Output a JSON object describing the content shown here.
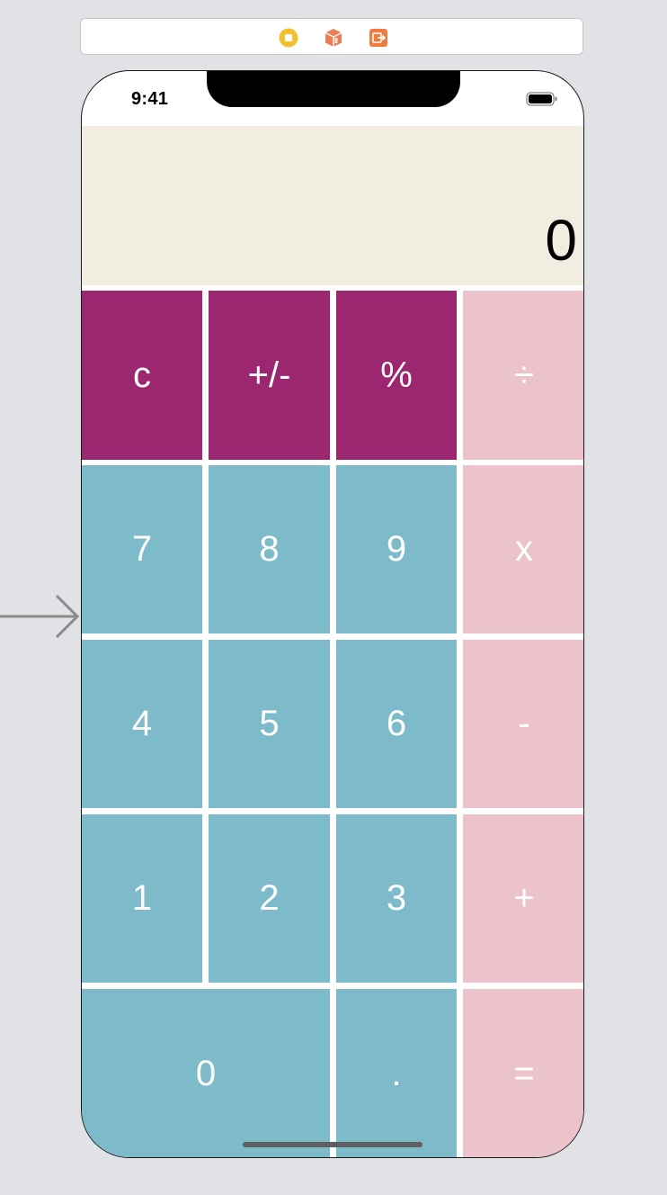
{
  "canvas": {
    "background": "#e1e2e6",
    "dock_icons": [
      {
        "name": "view-controller-icon",
        "color": "#f2c12e"
      },
      {
        "name": "first-responder-icon",
        "color": "#e97f52"
      },
      {
        "name": "exit-icon",
        "color": "#ef7b3d"
      }
    ],
    "entry_point": "initial-view-controller-arrow"
  },
  "status_bar": {
    "time": "9:41",
    "battery_icon": "battery-icon"
  },
  "display": {
    "value": "0",
    "background": "#f1ede1"
  },
  "keypad": {
    "colors": {
      "function": "#9b2770",
      "number": "#7dbaca",
      "operator": "#ecc3ca",
      "separator": "#ffffff"
    },
    "keys": {
      "clear": "c",
      "sign": "+/-",
      "percent": "%",
      "divide": "÷",
      "seven": "7",
      "eight": "8",
      "nine": "9",
      "multiply": "x",
      "four": "4",
      "five": "5",
      "six": "6",
      "subtract": "-",
      "one": "1",
      "two": "2",
      "three": "3",
      "add": "+",
      "zero": "0",
      "decimal": ".",
      "equals": "="
    }
  }
}
